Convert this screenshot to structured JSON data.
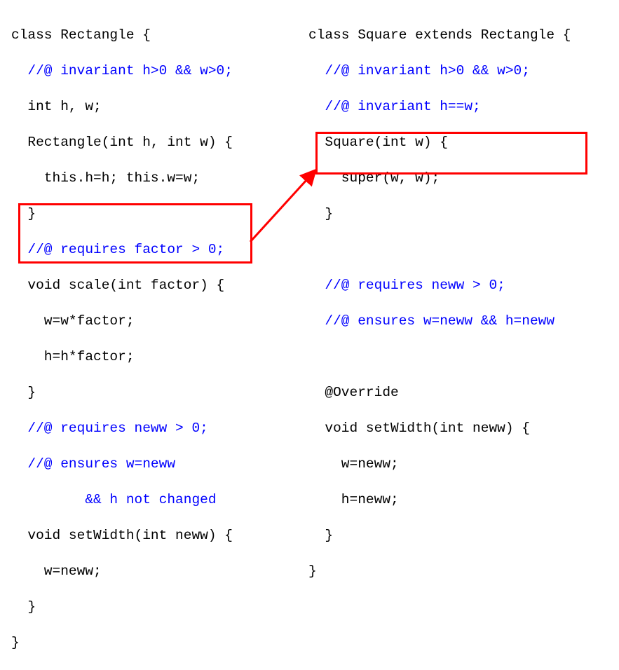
{
  "left": {
    "l1": "class Rectangle {",
    "l2": "  //@ invariant h>0 && w>0;",
    "l3": "  int h, w;",
    "l4": "  Rectangle(int h, int w) {",
    "l5": "    this.h=h; this.w=w;",
    "l6": "  }",
    "l7": "  //@ requires factor > 0;",
    "l8": "  void scale(int factor) {",
    "l9": "    w=w*factor;",
    "l10": "    h=h*factor;",
    "l11": "  }",
    "l12": "  //@ requires neww > 0;",
    "l13": "  //@ ensures w=neww",
    "l14": "         && h not changed",
    "l15": "  void setWidth(int neww) {",
    "l16": "    w=neww;",
    "l17": "  }",
    "l18": "}"
  },
  "right": {
    "l1": "class Square extends Rectangle {",
    "l2": "  //@ invariant h>0 && w>0;",
    "l3": "  //@ invariant h==w;",
    "l4": "  Square(int w) {",
    "l5": "    super(w, w);",
    "l6": "  }",
    "l7": "",
    "l8": "  //@ requires neww > 0;",
    "l9": "  //@ ensures w=neww && h=neww",
    "l10": "",
    "l11": "  @Override",
    "l12": "  void setWidth(int neww) {",
    "l13": "    w=neww;",
    "l14": "    h=neww;",
    "l15": "  }",
    "l16": "}"
  }
}
